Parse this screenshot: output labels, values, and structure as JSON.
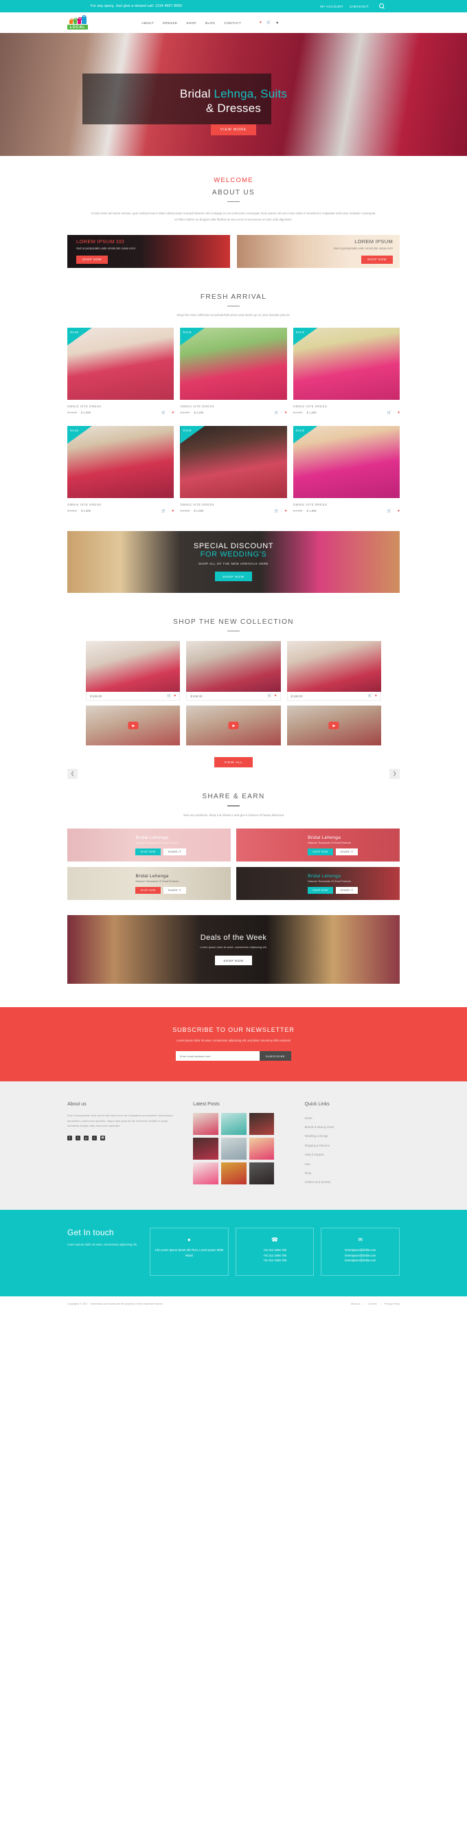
{
  "topbar": {
    "message": "For any query, Just give a missed call: 1234 4567 8900",
    "my_account": "MY ACCOUNT",
    "checkout": "CHECKOUT",
    "search_icon": "search-icon"
  },
  "header": {
    "logo_word": "LOCAL",
    "nav": [
      {
        "label": "ABOUT"
      },
      {
        "label": "DRESSE"
      },
      {
        "label": "SHOP"
      },
      {
        "label": "BLOG"
      },
      {
        "label": "CONTACT"
      }
    ],
    "icons": [
      {
        "name": "heart-icon",
        "glyph": "♥"
      },
      {
        "name": "cart-icon",
        "glyph": "🛒"
      },
      {
        "name": "user-icon",
        "glyph": "▲"
      }
    ]
  },
  "hero": {
    "title_part1": "Bridal ",
    "title_accent": "Lehnga, Suits",
    "title_part2": "& Dresses",
    "button": "VIEW MORE"
  },
  "about": {
    "eyebrow": "WELCOME",
    "title": "ABOUT US",
    "body": "Ut wisi enim ad minim veniam, quis nostrud exerci tation ullamcorper suscipit lobortis nisl ut aliquip ex ea commodo consequat. Duis autem vel eum iriure dolor in hendrerit in vulputate velit esse molestie consequat, vel illum dolore eu feugiat nulla facilisis at vero eros et accumsan et iusto odio dignissim."
  },
  "promos": [
    {
      "heading": "LOREM IPSUM DO",
      "text": "Sed ut perspiciatis unde omnis iste natus error",
      "button": "SHOP NOW"
    },
    {
      "heading": "LOREM IPSUM",
      "text": "Sed ut perspiciatis unde omnis iste natus error",
      "button": "SHOP NOW"
    }
  ],
  "fresh_arrival": {
    "title": "FRESH ARRIVAL",
    "subtitle": "Shop the new collection at wonderfull prices and stock up on your favorite pieces.",
    "badge": "SALE",
    "products": [
      {
        "name": "OMNIS ISTE DRESS",
        "price_old": "$ 2,000",
        "price_new": "$ 1,699"
      },
      {
        "name": "OMNIS ISTE DRESS",
        "price_old": "$ 2,000",
        "price_new": "$ 1,699"
      },
      {
        "name": "OMNIS ISTE DRESS",
        "price_old": "$ 2,000",
        "price_new": "$ 1,699"
      },
      {
        "name": "OMNIS ISTE DRESS",
        "price_old": "$ 2,000",
        "price_new": "$ 1,699"
      },
      {
        "name": "OMNIS ISTE DRESS",
        "price_old": "$ 2,000",
        "price_new": "$ 1,699"
      },
      {
        "name": "OMNIS ISTE DRESS",
        "price_old": "$ 2,000",
        "price_new": "$ 1,699"
      }
    ],
    "cart_icon": "cart-icon",
    "wish_icon": "heart-icon"
  },
  "discount_banner": {
    "line1": "SPECIAL DISCOUNT",
    "line2": "FOR WEDDING'S",
    "subtitle": "SHOP ALL OF THE NEW ARRIVALS HERE",
    "button": "SHOP NOW"
  },
  "collection": {
    "title": "SHOP THE NEW COLLECTION",
    "items": [
      {
        "price": "$ 536.00"
      },
      {
        "price": "$ 536.00"
      },
      {
        "price": "$ 536.00"
      }
    ],
    "prev_icon": "chevron-left-icon",
    "next_icon": "chevron-right-icon",
    "play_icon": "play-icon",
    "view_all": "VIEW ALL"
  },
  "share_earn": {
    "title": "SHARE & EARN",
    "subtitle": "See our products, shop it & Share it and get a chance of heavy discount",
    "cards": [
      {
        "heading": "Bridal Lehenga",
        "text": "Discover Thousands Of Great Products",
        "btn1": "SHOP NOW",
        "btn2": "SHARE IT"
      },
      {
        "heading": "Bridal Lehenga",
        "text": "Discover Thousands Of Great Products",
        "btn1": "SHOP NOW",
        "btn2": "SHARE IT"
      },
      {
        "heading": "Bridal Lehenga",
        "text": "Discover Thousands Of Great Products",
        "btn1": "SHOP NOW",
        "btn2": "SHARE IT"
      },
      {
        "heading": "Bridal Lehenga",
        "text": "Discover Thousands Of Great Products",
        "btn1": "SHOP NOW",
        "btn2": "SHARE IT"
      }
    ]
  },
  "deals": {
    "title": "Deals of the Week",
    "subtitle": "Lorem ipsum dolor sit amet, consectetur adipiscing elit.",
    "button": "SHOP NOW"
  },
  "newsletter": {
    "title": "SUBSCRIBE TO OUR NEWSLETTER",
    "subtitle": "Lorem ipsum dolor sit amet, consectetur adipiscing elit, sed diam nonummy nibh euismod",
    "placeholder": "Enter email address here",
    "button": "SUBSCRIBE"
  },
  "footer": {
    "about": {
      "title": "About us",
      "text": "Sed ut perspiciatis unde omnis iste natus error sit voluptatem accusantium doloremque laudantium, totam rem aperiam, eaque ipsa quae ab illo inventore veritatis et quasi architecto beatae vitae dicta sunt explicabo"
    },
    "socials": [
      {
        "name": "facebook-icon",
        "glyph": "f"
      },
      {
        "name": "twitter-icon",
        "glyph": "t"
      },
      {
        "name": "pinterest-icon",
        "glyph": "p"
      },
      {
        "name": "rss-icon",
        "glyph": "r"
      },
      {
        "name": "instagram-icon",
        "glyph": "▣"
      }
    ],
    "latest_posts": {
      "title": "Latest Posts"
    },
    "quick_links": {
      "title": "Quick Links",
      "items": [
        "Saree",
        "Brands & Beauty Items",
        "Wedding Lehenga",
        "Shipping & Returns",
        "Help & Support",
        "Cart",
        "Shop",
        "Clothes  and Jewelry"
      ]
    }
  },
  "get_in_touch": {
    "title": "Get In touch",
    "text": "Lorem ipsum dolor sit amet, consectetur adipiscing elit.",
    "address_icon": "location-pin-icon",
    "address": "123 Lorem Ipsum Street 4th Floor, Lorem Ipsum 3000 World",
    "phone_icon": "phone-icon",
    "phones": [
      "+91 012 3456 789",
      "+91 012 3456 789",
      "+91 012 3456 789"
    ],
    "email_icon": "envelope-icon",
    "emails": [
      "loremipsum@dollar.com",
      "loremipsum@dollar.com",
      "loremipsum@dollar.com"
    ]
  },
  "copyright": {
    "text": "Copyrights © 2017 . Trademarks and brands are the property of their respective owners",
    "links": [
      "About us",
      "Careers",
      "Privacy Policy"
    ],
    "separator": "|"
  },
  "colors": {
    "teal": "#10c4c4",
    "coral": "#ef4a43",
    "red": "#ef3d36",
    "dark": "#4a4a4a",
    "grey_bg": "#efefef"
  }
}
